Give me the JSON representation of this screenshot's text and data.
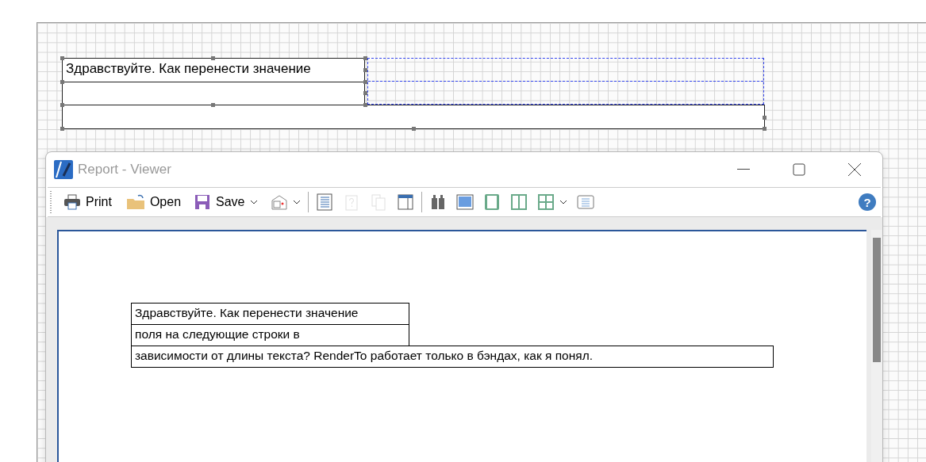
{
  "designer": {
    "text_box": "Здравствуйте. Как перенести значение"
  },
  "viewer": {
    "window": {
      "title": "Report - Viewer"
    },
    "toolbar": [
      {
        "label": "Print",
        "dropdown": false,
        "disabled": false
      },
      {
        "label": "Open",
        "dropdown": false,
        "disabled": false
      },
      {
        "label": "Save",
        "dropdown": true,
        "disabled": false
      },
      {
        "dropdown": true,
        "disabled": false
      },
      {
        "dropdown": false,
        "disabled": false
      },
      {
        "dropdown": false,
        "disabled": true
      },
      {
        "dropdown": false,
        "disabled": true
      },
      {
        "dropdown": false,
        "disabled": false
      },
      {
        "dropdown": false,
        "disabled": false
      },
      {
        "dropdown": false,
        "disabled": false
      },
      {
        "dropdown": false,
        "disabled": false
      },
      {
        "dropdown": false,
        "disabled": false
      },
      {
        "dropdown": true,
        "disabled": false
      },
      {
        "dropdown": false,
        "disabled": false
      }
    ],
    "help": "?",
    "report_rows": [
      "Здравствуйте. Как перенести значение",
      "поля на следующие строки в",
      "зависимости от длины текста? RenderTo работает только в бэндах, как я понял."
    ]
  }
}
